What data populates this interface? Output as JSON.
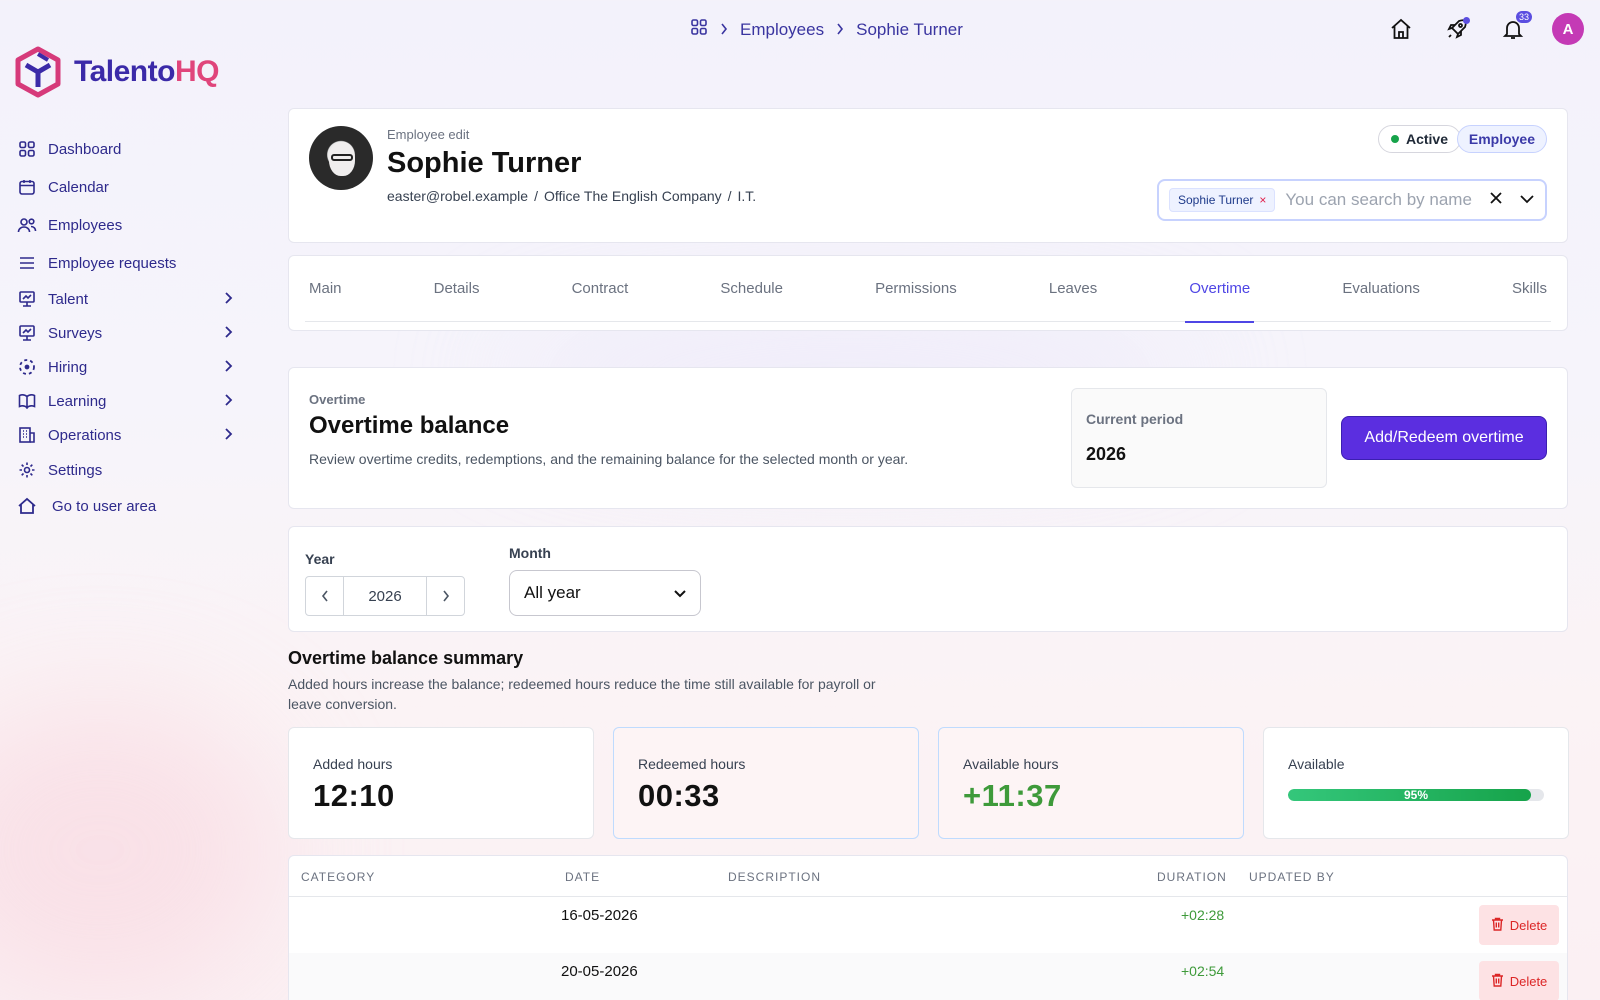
{
  "brand": {
    "name_a": "Talento",
    "name_b": "HQ"
  },
  "sidebar": {
    "items": [
      {
        "label": "Dashboard",
        "icon": "grid-icon",
        "has_children": false
      },
      {
        "label": "Calendar",
        "icon": "calendar-icon",
        "has_children": false
      },
      {
        "label": "Employees",
        "icon": "users-icon",
        "has_children": false
      },
      {
        "label": "Employee requests",
        "icon": "list-icon",
        "has_children": false
      },
      {
        "label": "Talent",
        "icon": "presentation-icon",
        "has_children": true
      },
      {
        "label": "Surveys",
        "icon": "presentation-icon",
        "has_children": true
      },
      {
        "label": "Hiring",
        "icon": "dashed-circle-icon",
        "has_children": true
      },
      {
        "label": "Learning",
        "icon": "book-icon",
        "has_children": true
      },
      {
        "label": "Operations",
        "icon": "building-icon",
        "has_children": true
      },
      {
        "label": "Settings",
        "icon": "gear-icon",
        "has_children": false
      },
      {
        "label": "Go to user area",
        "icon": "home-icon",
        "has_children": false
      }
    ]
  },
  "breadcrumb": {
    "items": [
      "Employees",
      "Sophie Turner"
    ]
  },
  "topbar": {
    "notifications_count": "33",
    "avatar_initial": "A"
  },
  "employee": {
    "kicker": "Employee edit",
    "name": "Sophie Turner",
    "email": "easter@robel.example",
    "office": "Office The English Company",
    "department": "I.T.",
    "status": "Active",
    "role": "Employee",
    "separator": "/"
  },
  "employee_select": {
    "chip_label": "Sophie Turner",
    "chip_remove": "×",
    "placeholder": "You can search by name"
  },
  "tabs": [
    "Main",
    "Details",
    "Contract",
    "Schedule",
    "Permissions",
    "Leaves",
    "Overtime",
    "Evaluations",
    "Skills"
  ],
  "active_tab": "Overtime",
  "overtime": {
    "kicker": "Overtime",
    "title": "Overtime balance",
    "description": "Review overtime credits, redemptions, and the remaining balance for the selected month or year.",
    "period_label": "Current period",
    "period_value": "2026",
    "add_button": "Add/Redeem overtime"
  },
  "filters": {
    "year_label": "Year",
    "year_value": "2026",
    "month_label": "Month",
    "month_value": "All year"
  },
  "summary": {
    "title": "Overtime balance summary",
    "description": "Added hours increase the balance; redeemed hours reduce the time still available for payroll or leave conversion.",
    "stats": [
      {
        "label": "Added hours",
        "value": "12:10"
      },
      {
        "label": "Redeemed hours",
        "value": "00:33"
      },
      {
        "label": "Available hours",
        "value": "+11:37"
      }
    ],
    "available_label": "Available",
    "available_percent": 95,
    "available_text": "95%"
  },
  "table": {
    "columns": [
      "CATEGORY",
      "DATE",
      "DESCRIPTION",
      "DURATION",
      "UPDATED BY"
    ],
    "rows": [
      {
        "category": "",
        "date": "16-05-2026",
        "description": "",
        "duration": "+02:28",
        "updated_by": "",
        "action": "Delete"
      },
      {
        "category": "",
        "date": "20-05-2026",
        "description": "",
        "duration": "+02:54",
        "updated_by": "",
        "action": "Delete"
      }
    ]
  },
  "colors": {
    "primary": "#5b2ee0",
    "brand_a": "#3b2aa8",
    "brand_b": "#e0457b",
    "positive": "#3e9a3a",
    "danger": "#dc2626"
  }
}
